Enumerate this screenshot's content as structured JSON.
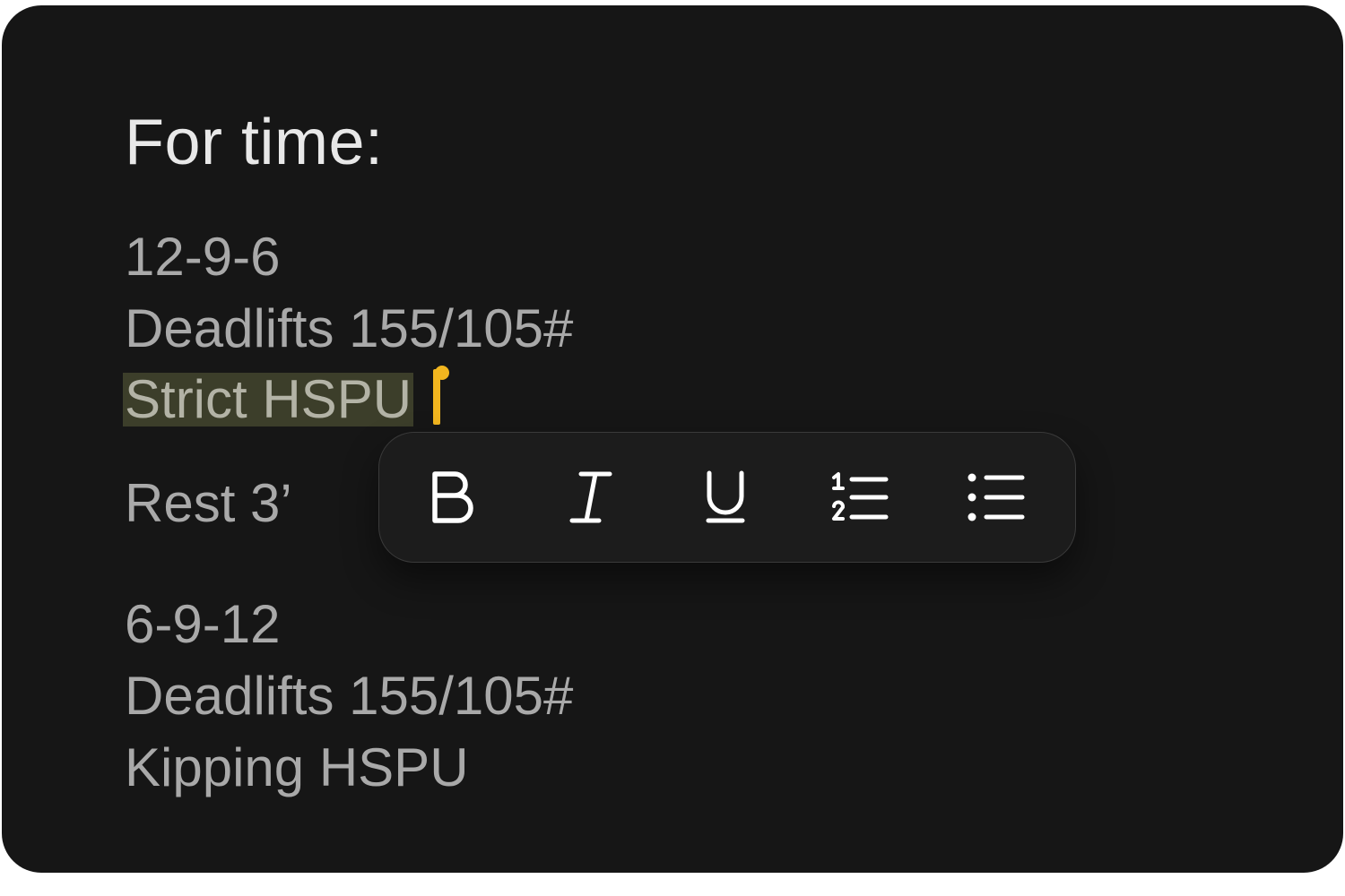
{
  "editor": {
    "title": "For time:",
    "lines": [
      "12-9-6",
      "Deadlifts 155/105#",
      "Strict HSPU",
      "Rest 3’",
      "6-9-12",
      "Deadlifts 155/105#",
      "Kipping HSPU"
    ],
    "selected_line_index": 2
  },
  "toolbar": {
    "items": [
      {
        "name": "bold",
        "icon": "bold-icon"
      },
      {
        "name": "italic",
        "icon": "italic-icon"
      },
      {
        "name": "underline",
        "icon": "underline-icon"
      },
      {
        "name": "ordered-list",
        "icon": "ordered-list-icon"
      },
      {
        "name": "bullet-list",
        "icon": "bullet-list-icon"
      }
    ]
  },
  "colors": {
    "background": "#161616",
    "title_text": "#e8e8e8",
    "body_text": "#a9a9a9",
    "selection_highlight": "#3c3e2a",
    "caret": "#f2b61f",
    "toolbar_background": "#1c1c1c",
    "toolbar_icon": "#ffffff"
  }
}
